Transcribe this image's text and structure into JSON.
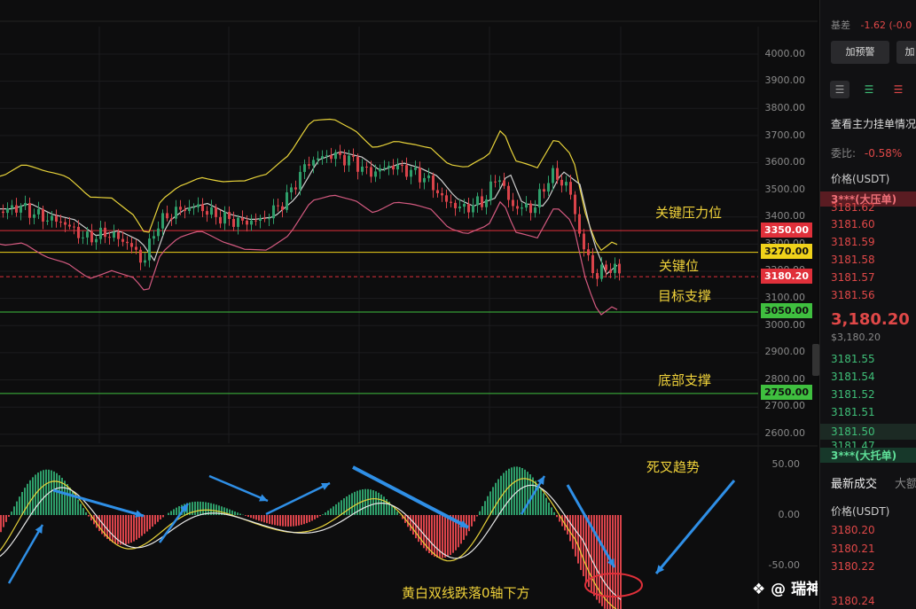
{
  "chart": {
    "y_axis_labels": [
      "4000.00",
      "3900.00",
      "3800.00",
      "3700.00",
      "3600.00",
      "3500.00",
      "3400.00",
      "3300.00",
      "3200.00",
      "3100.00",
      "3000.00",
      "2900.00",
      "2800.00",
      "2700.00",
      "2600.00"
    ],
    "macd_axis_labels": [
      "50.00",
      "0.00",
      "-50.00"
    ],
    "levels": [
      {
        "value": "3350.00",
        "color": "#e0303a",
        "line": "#e0303a"
      },
      {
        "value": "3270.00",
        "color": "#f0d21a",
        "line": "#f0d21a"
      },
      {
        "value": "3180.20",
        "color": "#e0303a",
        "line": "#e0303a"
      },
      {
        "value": "3050.00",
        "color": "#3fbf3f",
        "line": "#3fbf3f"
      },
      {
        "value": "2750.00",
        "color": "#3fbf3f",
        "line": "#3fbf3f"
      }
    ],
    "annotations": {
      "resistance": "关键压力位",
      "key_level": "关键位",
      "target_support": "目标支撑",
      "bottom_support": "底部支撑",
      "death_cross": "死叉趋势",
      "macd_note": "黄白双线跌落0轴下方"
    },
    "watermark": "瑞神看趋势",
    "colors": {
      "up": "#2e9e6a",
      "down": "#d9434a",
      "boll_upper": "#e8d33a",
      "boll_mid": "#cfcfcf",
      "boll_lower": "#d45a80",
      "arrow": "#2f8fe6"
    }
  },
  "sidebar": {
    "basis_label": "基差",
    "basis_value": "-1.62 (-0.0",
    "alert_button": "加预警",
    "add_button": "加",
    "view_orders": "查看主力挂单情况",
    "commission_label": "委比:",
    "commission_value": "-0.58%",
    "price_header": "价格(USDT)",
    "big_ask": "3***(大压单)",
    "asks": [
      "3181.62",
      "3181.60",
      "3181.59",
      "3181.58",
      "3181.57",
      "3181.56"
    ],
    "last_price": "3,180.20",
    "last_price_usd": "$3,180.20",
    "bids": [
      "3181.55",
      "3181.54",
      "3181.52",
      "3181.51",
      "3181.50",
      "3181.47"
    ],
    "big_bid": "3***(大托单)",
    "tab_latest": "最新成交",
    "tab_big": "大额",
    "trades_header": "价格(USDT)",
    "trades": [
      "3180.20",
      "3180.21",
      "3180.22",
      "3180.24"
    ]
  }
}
